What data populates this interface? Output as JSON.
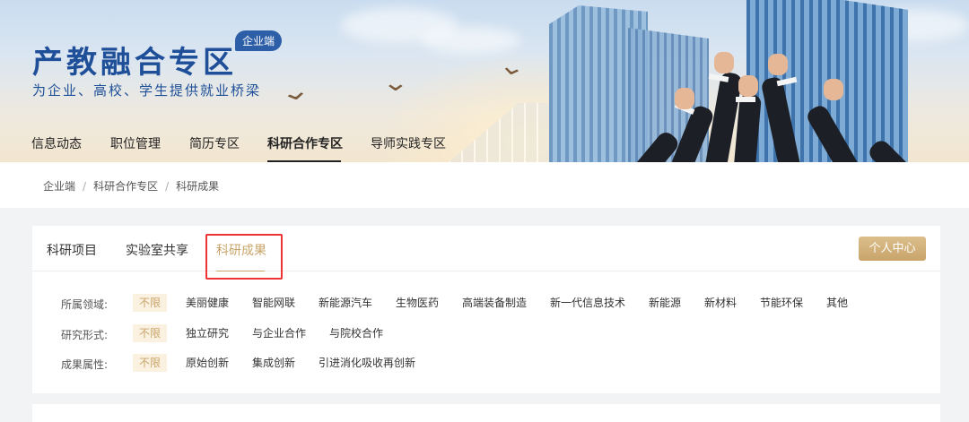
{
  "banner": {
    "title": "产教融合专区",
    "badge": "企业端",
    "subtitle": "为企业、高校、学生提供就业桥梁"
  },
  "topnav": {
    "items": [
      {
        "label": "信息动态",
        "active": false
      },
      {
        "label": "职位管理",
        "active": false
      },
      {
        "label": "简历专区",
        "active": false
      },
      {
        "label": "科研合作专区",
        "active": true
      },
      {
        "label": "导师实践专区",
        "active": false
      }
    ]
  },
  "breadcrumb": [
    "企业端",
    "科研合作专区",
    "科研成果"
  ],
  "breadcrumb_separator": "/",
  "tabs": [
    {
      "label": "科研项目",
      "active": false
    },
    {
      "label": "实验室共享",
      "active": false
    },
    {
      "label": "科研成果",
      "active": true
    }
  ],
  "personal_center": "个人中心",
  "filters": [
    {
      "label": "所属领域:",
      "options": [
        "不限",
        "美丽健康",
        "智能网联",
        "新能源汽车",
        "生物医药",
        "高端装备制造",
        "新一代信息技术",
        "新能源",
        "新材料",
        "节能环保",
        "其他"
      ],
      "selected": "不限"
    },
    {
      "label": "研究形式:",
      "options": [
        "不限",
        "独立研究",
        "与企业合作",
        "与院校合作"
      ],
      "selected": "不限"
    },
    {
      "label": "成果属性:",
      "options": [
        "不限",
        "原始创新",
        "集成创新",
        "引进消化吸收再创新"
      ],
      "selected": "不限"
    }
  ],
  "colors": {
    "brand_blue": "#1e4f98",
    "accent_gold": "#c9a46a",
    "selected_bg": "#fbf1e1",
    "highlight_red": "#ee3333"
  }
}
